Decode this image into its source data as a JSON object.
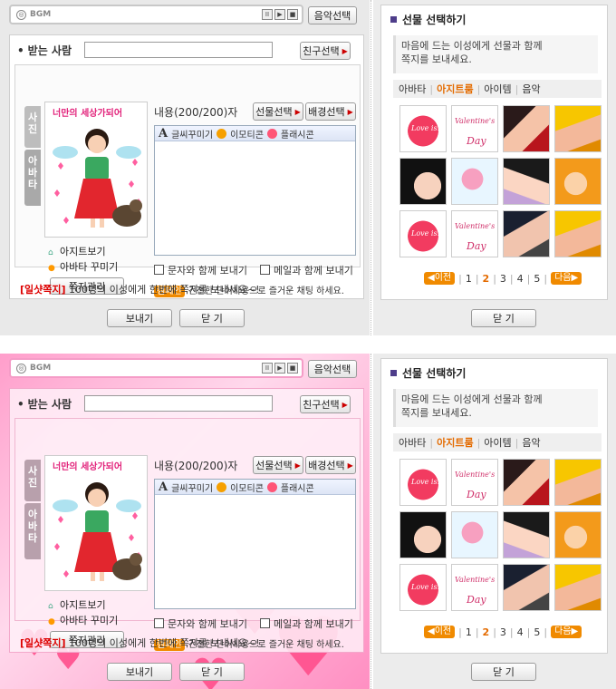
{
  "bgm": {
    "icon": "music-disc-icon",
    "label": "BGM",
    "controls": [
      "II",
      "▶",
      "■"
    ],
    "music_button": "음악선택"
  },
  "recipient": {
    "label": "받는 사람",
    "value": "",
    "friend_button": "친구선택"
  },
  "tabs": [
    "사진",
    "아바타"
  ],
  "avatar": {
    "title": "너만의 세상가되어"
  },
  "links": {
    "agit": "아지트보기",
    "avatar_deco": "아바타 꾸미기"
  },
  "note_manage_button": "쪽지관리",
  "content": {
    "label": "내용(200/200)자",
    "gift_button": "선물선택",
    "bg_button": "배경선택"
  },
  "toolbar": {
    "font": "글씨꾸미기",
    "emoticon": "이모티콘",
    "flash": "플래시콘"
  },
  "options": {
    "with_sms": "문자와 함께 보내기",
    "with_mail": "메일과 함께 보내기"
  },
  "campaign": {
    "tag": "캠페인",
    "text": "건전한 단어사용으로 즐거운 채팅 하세요."
  },
  "promo": {
    "highlight": "[일샷쪽지]",
    "text": "100명의 이성에게 한번에 쪽지를 보내세요~!"
  },
  "buttons": {
    "send": "보내기",
    "close": "닫 기"
  },
  "gift": {
    "title": "선물 선택하기",
    "desc_line1": "마음에 드는 이성에게 선물과 함께",
    "desc_line2": "쪽지를 보내세요.",
    "tabs": [
      "아바타",
      "아지트룸",
      "아이템",
      "음악"
    ],
    "active_tab": "아지트룸",
    "pager": {
      "prev": "이전",
      "pages": [
        "1",
        "2",
        "3",
        "4",
        "5"
      ],
      "current": "2",
      "next": "다음"
    },
    "close": "닫 기"
  }
}
